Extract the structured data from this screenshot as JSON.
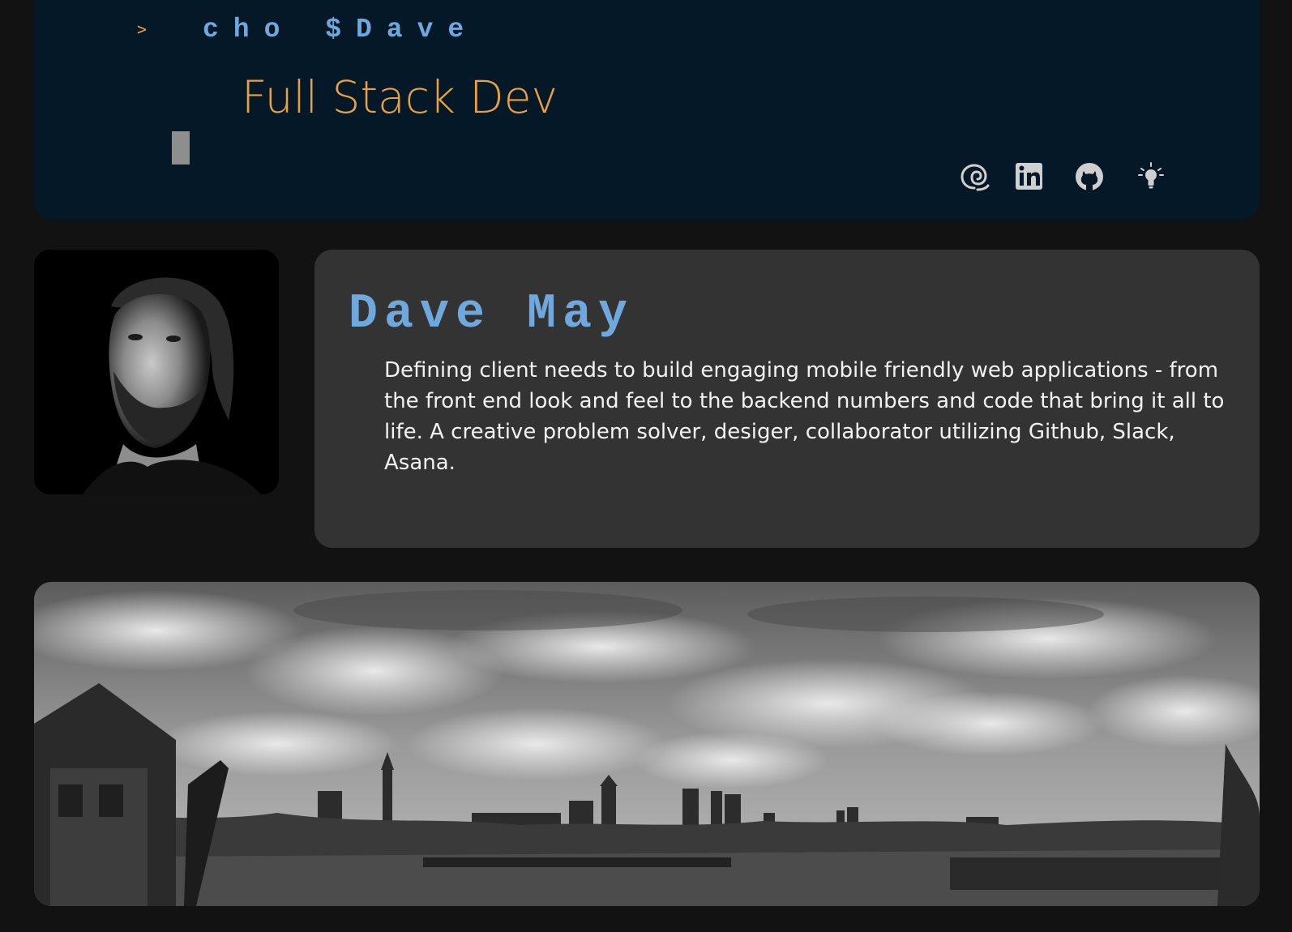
{
  "terminal": {
    "prompt": ">",
    "command": "cho $Dave",
    "subtitle": "Full Stack Dev"
  },
  "social_links": [
    {
      "icon": "email-swirl-icon"
    },
    {
      "icon": "linkedin-icon"
    },
    {
      "icon": "github-icon"
    },
    {
      "icon": "lightbulb-icon"
    }
  ],
  "profile": {
    "name": "Dave May",
    "bio": "Defining client needs to build engaging mobile friendly web applications - from the front end look and feel to the backend numbers and code that bring it all to life. A creative problem solver, desiger, collaborator utilizing Github, Slack, Asana."
  },
  "colors": {
    "background": "#121212",
    "terminal_bg": "#051827",
    "card_bg": "#333333",
    "accent_orange": "#e8a33f",
    "accent_blue": "#6fa8dc",
    "icon_gray": "#cfcfcf"
  }
}
